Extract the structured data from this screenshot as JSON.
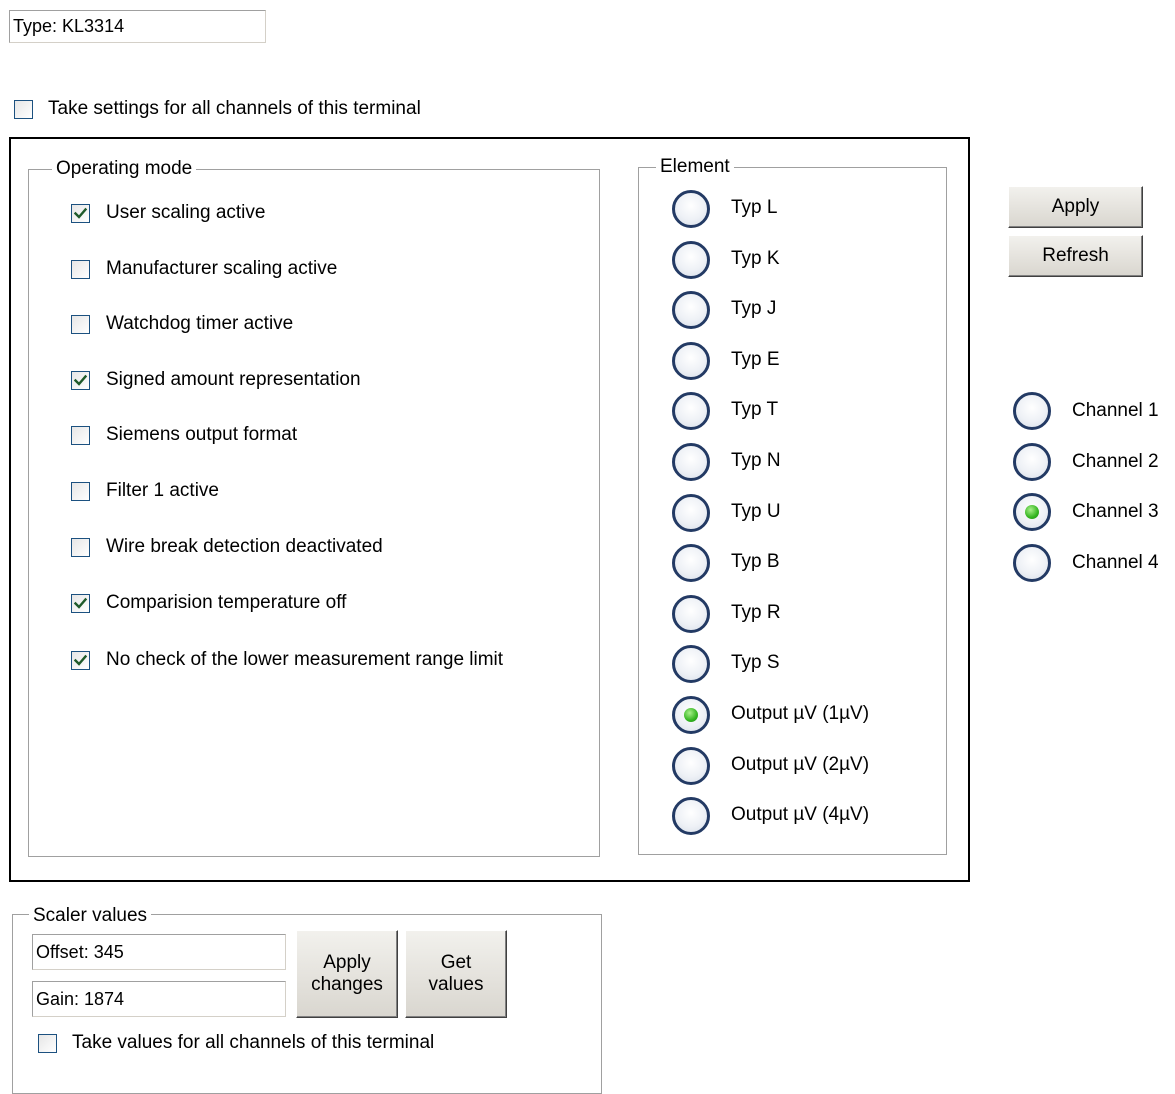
{
  "type_field": {
    "value": "Type: KL3314"
  },
  "take_settings_all": {
    "label": "Take settings for all channels of this terminal",
    "checked": false
  },
  "operating_mode": {
    "title": "Operating mode",
    "options": [
      {
        "label": "User scaling active",
        "checked": true
      },
      {
        "label": "Manufacturer scaling active",
        "checked": false
      },
      {
        "label": "Watchdog timer active",
        "checked": false
      },
      {
        "label": "Signed amount representation",
        "checked": true
      },
      {
        "label": "Siemens output format",
        "checked": false
      },
      {
        "label": "Filter 1 active",
        "checked": false
      },
      {
        "label": "Wire break detection deactivated",
        "checked": false
      },
      {
        "label": "Comparision temperature off",
        "checked": true
      },
      {
        "label": "No check of the lower measurement range limit",
        "checked": true
      }
    ]
  },
  "element": {
    "title": "Element",
    "options": [
      {
        "label": "Typ L",
        "selected": false
      },
      {
        "label": "Typ K",
        "selected": false
      },
      {
        "label": "Typ J",
        "selected": false
      },
      {
        "label": "Typ E",
        "selected": false
      },
      {
        "label": "Typ T",
        "selected": false
      },
      {
        "label": "Typ N",
        "selected": false
      },
      {
        "label": "Typ U",
        "selected": false
      },
      {
        "label": "Typ B",
        "selected": false
      },
      {
        "label": "Typ R",
        "selected": false
      },
      {
        "label": "Typ S",
        "selected": false
      },
      {
        "label": "Output µV (1µV)",
        "selected": true
      },
      {
        "label": "Output µV (2µV)",
        "selected": false
      },
      {
        "label": "Output µV (4µV)",
        "selected": false
      }
    ]
  },
  "buttons": {
    "apply": "Apply",
    "refresh": "Refresh"
  },
  "channels": [
    {
      "label": "Channel 1",
      "selected": false
    },
    {
      "label": "Channel 2",
      "selected": false
    },
    {
      "label": "Channel 3",
      "selected": true
    },
    {
      "label": "Channel 4",
      "selected": false
    }
  ],
  "scaler": {
    "title": "Scaler values",
    "offset": "Offset: 345",
    "gain": "Gain: 1874",
    "apply_changes_line1": "Apply",
    "apply_changes_line2": "changes",
    "get_values_line1": "Get",
    "get_values_line2": "values",
    "take_values_all": {
      "label": "Take values for all channels of this terminal",
      "checked": false
    }
  },
  "colors": {
    "radio_border": "#233a64",
    "radio_selected_dot": "#34b521",
    "checkbox_border": "#1c5180",
    "button_face": "#e4e2dc"
  }
}
